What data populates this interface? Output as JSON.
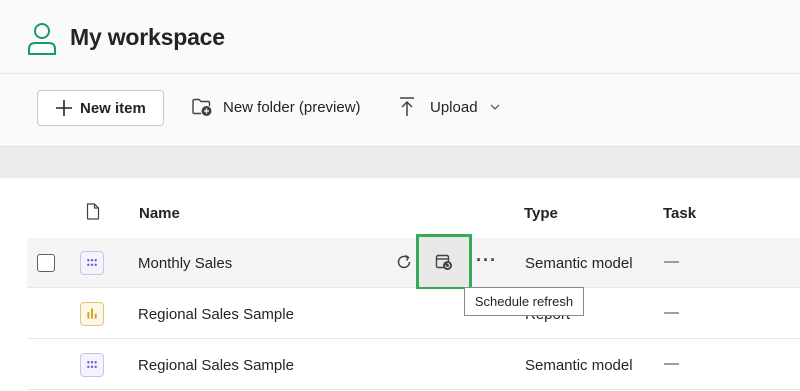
{
  "workspace": {
    "title": "My workspace",
    "icon": "person-icon"
  },
  "toolbar": {
    "new_item_label": "New item",
    "new_folder_label": "New folder (preview)",
    "upload_label": "Upload"
  },
  "table": {
    "headers": {
      "name": "Name",
      "type": "Type",
      "task": "Task"
    },
    "rows": [
      {
        "name": "Monthly Sales",
        "type": "Semantic model",
        "task": "—",
        "icon": "semantic-model-icon"
      },
      {
        "name": "Regional Sales Sample",
        "type": "Report",
        "task": "—",
        "icon": "report-icon"
      },
      {
        "name": "Regional Sales Sample",
        "type": "Semantic model",
        "task": "—",
        "icon": "semantic-model-icon"
      }
    ]
  },
  "row_actions": {
    "more": "···"
  },
  "tooltip": {
    "text": "Schedule refresh"
  },
  "colors": {
    "accent_green": "#3aa85a",
    "workspace_icon": "#1a9a6b",
    "semantic_model_dots": "#6b5bd3",
    "report_bars": "#d69b1c"
  }
}
